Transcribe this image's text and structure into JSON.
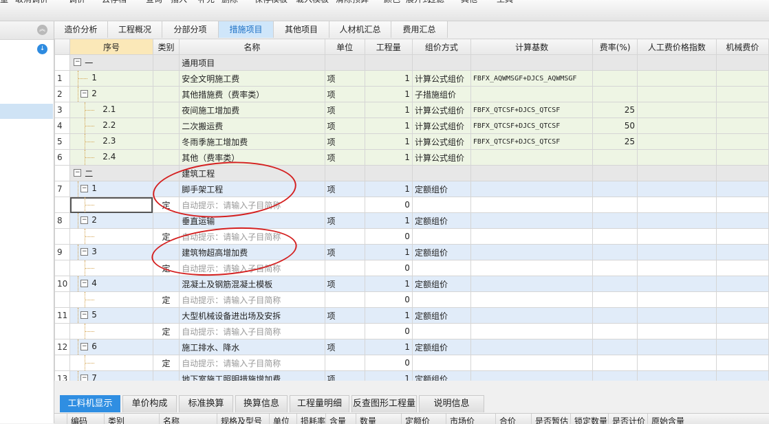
{
  "toolbar": {
    "items": [
      "量",
      "取消调价",
      "调价",
      "云存档",
      "查询",
      "插入",
      "补充",
      "删除",
      "保存模板",
      "载入模板",
      "清除预算",
      "颜色",
      "展开到",
      "过滤",
      "其他",
      "工具"
    ]
  },
  "tabs": [
    "造价分析",
    "工程概况",
    "分部分项",
    "措施项目",
    "其他项目",
    "人材机汇总",
    "费用汇总"
  ],
  "active_tab": "措施项目",
  "columns": [
    "序号",
    "类别",
    "名称",
    "单位",
    "工程量",
    "组价方式",
    "计算基数",
    "费率(%)",
    "人工费价格指数",
    "机械费价"
  ],
  "rows": [
    {
      "no": "",
      "seq": "一",
      "type": "",
      "name": "通用项目",
      "unit": "",
      "qty": "",
      "method": "",
      "base": "",
      "rate": "",
      "style": "gray",
      "level": 0,
      "box": "−"
    },
    {
      "no": "1",
      "seq": "1",
      "type": "",
      "name": "安全文明施工费",
      "unit": "项",
      "qty": "1",
      "method": "计算公式组价",
      "base": "FBFX_AQWMSGF+DJCS_AQWMSGF",
      "rate": "",
      "style": "green",
      "level": 1,
      "box": ""
    },
    {
      "no": "2",
      "seq": "2",
      "type": "",
      "name": "其他措施费（费率类）",
      "unit": "项",
      "qty": "1",
      "method": "子措施组价",
      "base": "",
      "rate": "",
      "style": "green",
      "level": 1,
      "box": "−"
    },
    {
      "no": "3",
      "seq": "2.1",
      "type": "",
      "name": "夜间施工增加费",
      "unit": "项",
      "qty": "1",
      "method": "计算公式组价",
      "base": "FBFX_QTCSF+DJCS_QTCSF",
      "rate": "25",
      "style": "green",
      "level": 2,
      "box": ""
    },
    {
      "no": "4",
      "seq": "2.2",
      "type": "",
      "name": "二次搬运费",
      "unit": "项",
      "qty": "1",
      "method": "计算公式组价",
      "base": "FBFX_QTCSF+DJCS_QTCSF",
      "rate": "50",
      "style": "green",
      "level": 2,
      "box": ""
    },
    {
      "no": "5",
      "seq": "2.3",
      "type": "",
      "name": "冬雨季施工增加费",
      "unit": "项",
      "qty": "1",
      "method": "计算公式组价",
      "base": "FBFX_QTCSF+DJCS_QTCSF",
      "rate": "25",
      "style": "green",
      "level": 2,
      "box": ""
    },
    {
      "no": "6",
      "seq": "2.4",
      "type": "",
      "name": "其他（费率类）",
      "unit": "项",
      "qty": "1",
      "method": "计算公式组价",
      "base": "",
      "rate": "",
      "style": "green",
      "level": 2,
      "box": ""
    },
    {
      "no": "",
      "seq": "二",
      "type": "",
      "name": "建筑工程",
      "unit": "",
      "qty": "",
      "method": "",
      "base": "",
      "rate": "",
      "style": "gray",
      "level": 0,
      "box": "−"
    },
    {
      "no": "7",
      "seq": "1",
      "type": "",
      "name": "脚手架工程",
      "unit": "项",
      "qty": "1",
      "method": "定额组价",
      "base": "",
      "rate": "",
      "style": "blue",
      "level": 1,
      "box": "−"
    },
    {
      "no": "",
      "seq": "",
      "type": "定",
      "name": "自动提示：请输入子目简称",
      "unit": "",
      "qty": "0",
      "method": "",
      "base": "",
      "rate": "",
      "style": "white",
      "level": 2,
      "box": "",
      "hint": true,
      "focus": true
    },
    {
      "no": "8",
      "seq": "2",
      "type": "",
      "name": "垂直运输",
      "unit": "项",
      "qty": "1",
      "method": "定额组价",
      "base": "",
      "rate": "",
      "style": "blue",
      "level": 1,
      "box": "−"
    },
    {
      "no": "",
      "seq": "",
      "type": "定",
      "name": "自动提示：请输入子目简称",
      "unit": "",
      "qty": "0",
      "method": "",
      "base": "",
      "rate": "",
      "style": "white",
      "level": 2,
      "box": "",
      "hint": true
    },
    {
      "no": "9",
      "seq": "3",
      "type": "",
      "name": "建筑物超高增加费",
      "unit": "项",
      "qty": "1",
      "method": "定额组价",
      "base": "",
      "rate": "",
      "style": "blue",
      "level": 1,
      "box": "−"
    },
    {
      "no": "",
      "seq": "",
      "type": "定",
      "name": "自动提示：请输入子目简称",
      "unit": "",
      "qty": "0",
      "method": "",
      "base": "",
      "rate": "",
      "style": "white",
      "level": 2,
      "box": "",
      "hint": true
    },
    {
      "no": "10",
      "seq": "4",
      "type": "",
      "name": "混凝土及钢筋混凝土模板",
      "unit": "项",
      "qty": "1",
      "method": "定额组价",
      "base": "",
      "rate": "",
      "style": "blue",
      "level": 1,
      "box": "−"
    },
    {
      "no": "",
      "seq": "",
      "type": "定",
      "name": "自动提示：请输入子目简称",
      "unit": "",
      "qty": "0",
      "method": "",
      "base": "",
      "rate": "",
      "style": "white",
      "level": 2,
      "box": "",
      "hint": true
    },
    {
      "no": "11",
      "seq": "5",
      "type": "",
      "name": "大型机械设备进出场及安拆",
      "unit": "项",
      "qty": "1",
      "method": "定额组价",
      "base": "",
      "rate": "",
      "style": "blue",
      "level": 1,
      "box": "−"
    },
    {
      "no": "",
      "seq": "",
      "type": "定",
      "name": "自动提示：请输入子目简称",
      "unit": "",
      "qty": "0",
      "method": "",
      "base": "",
      "rate": "",
      "style": "white",
      "level": 2,
      "box": "",
      "hint": true
    },
    {
      "no": "12",
      "seq": "6",
      "type": "",
      "name": "施工排水、降水",
      "unit": "项",
      "qty": "1",
      "method": "定额组价",
      "base": "",
      "rate": "",
      "style": "blue",
      "level": 1,
      "box": "−"
    },
    {
      "no": "",
      "seq": "",
      "type": "定",
      "name": "自动提示：请输入子目简称",
      "unit": "",
      "qty": "0",
      "method": "",
      "base": "",
      "rate": "",
      "style": "white",
      "level": 2,
      "box": "",
      "hint": true
    },
    {
      "no": "13",
      "seq": "7",
      "type": "",
      "name": "地下室施工照明措施增加费",
      "unit": "项",
      "qty": "1",
      "method": "定额组价",
      "base": "",
      "rate": "",
      "style": "blue",
      "level": 1,
      "box": "−"
    }
  ],
  "bottom_tabs": [
    "工料机显示",
    "单价构成",
    "标准换算",
    "换算信息",
    "工程量明细",
    "反查图形工程量",
    "说明信息"
  ],
  "active_bottom_tab": "工料机显示",
  "bottom_columns": [
    "编码",
    "类别",
    "名称",
    "规格及型号",
    "单位",
    "损耗率",
    "含量",
    "数量",
    "定额价",
    "市场价",
    "合价",
    "是否暂估",
    "锁定数量",
    "是否计价",
    "原始含量"
  ],
  "colors": {
    "active_tab": "#2f8ee2",
    "annotation": "#d42020",
    "green_row": "#eef5e4",
    "blue_row": "#e1ecf9",
    "gray_row": "#e7e7e7"
  }
}
